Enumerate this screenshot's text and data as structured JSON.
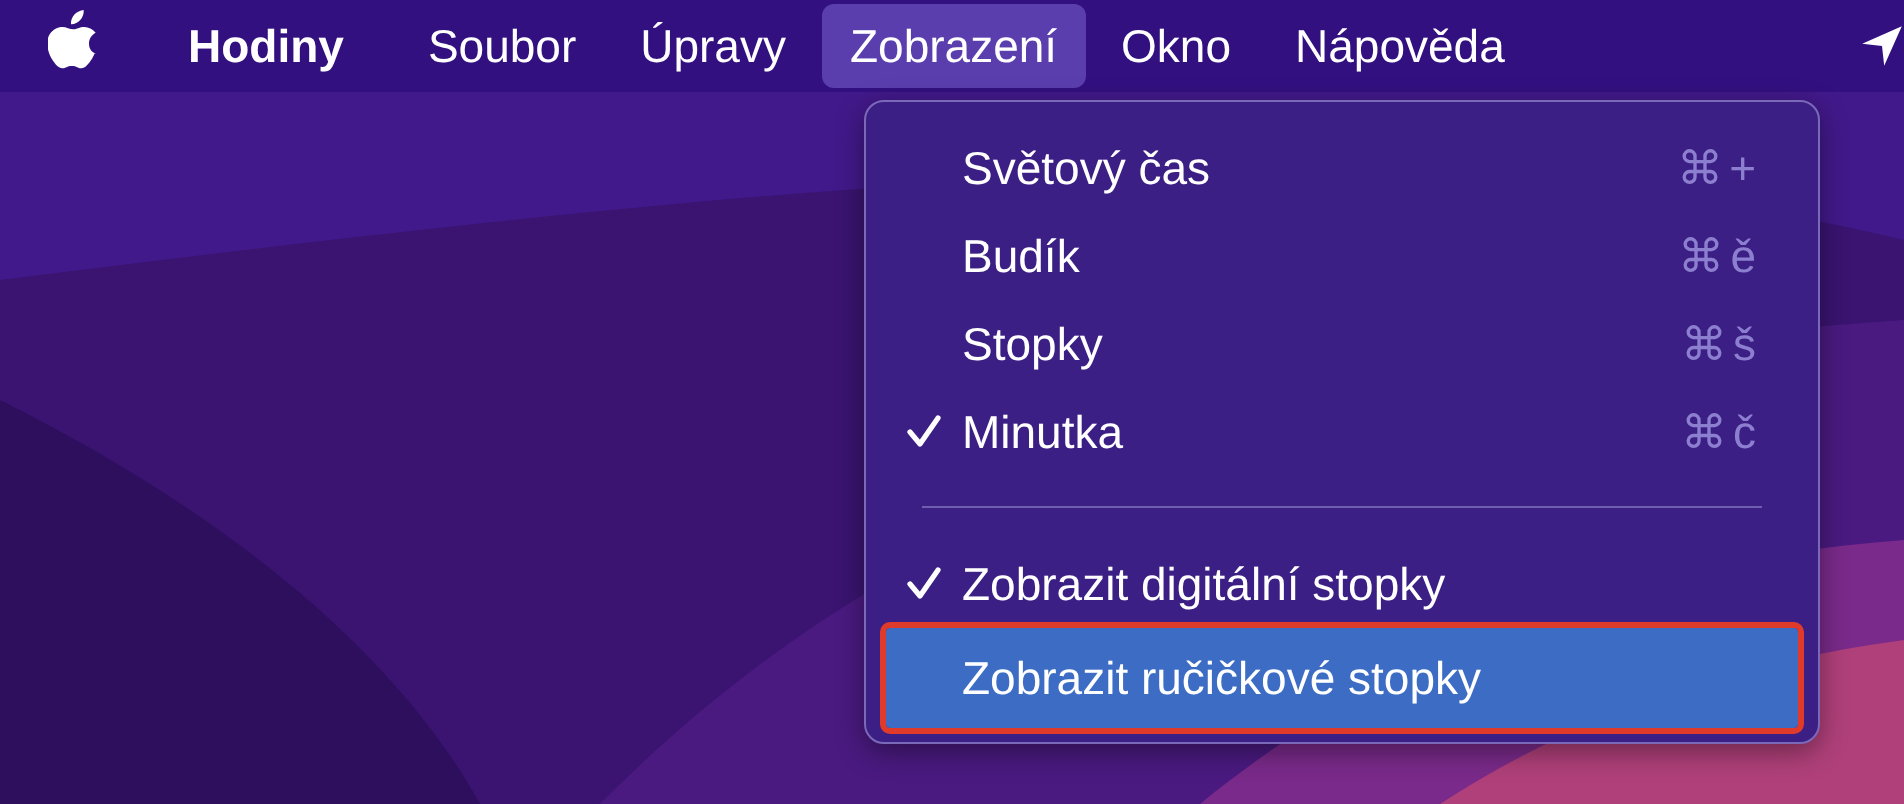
{
  "menu_bar": {
    "app_name": "Hodiny",
    "menus": [
      {
        "label": "Soubor",
        "selected": false
      },
      {
        "label": "Úpravy",
        "selected": false
      },
      {
        "label": "Zobrazení",
        "selected": true
      },
      {
        "label": "Okno",
        "selected": false
      },
      {
        "label": "Nápověda",
        "selected": false
      }
    ]
  },
  "dropdown": {
    "sections": [
      {
        "items": [
          {
            "label": "Světový čas",
            "shortcut": "⌘+",
            "checked": false,
            "selected": false,
            "outlined": false
          },
          {
            "label": "Budík",
            "shortcut": "⌘ě",
            "checked": false,
            "selected": false,
            "outlined": false
          },
          {
            "label": "Stopky",
            "shortcut": "⌘š",
            "checked": false,
            "selected": false,
            "outlined": false
          },
          {
            "label": "Minutka",
            "shortcut": "⌘č",
            "checked": true,
            "selected": false,
            "outlined": false
          }
        ]
      },
      {
        "items": [
          {
            "label": "Zobrazit digitální stopky",
            "checked": true,
            "selected": false,
            "outlined": false
          },
          {
            "label": "Zobrazit ručičkové stopky",
            "checked": false,
            "selected": true,
            "outlined": true
          }
        ]
      }
    ]
  }
}
